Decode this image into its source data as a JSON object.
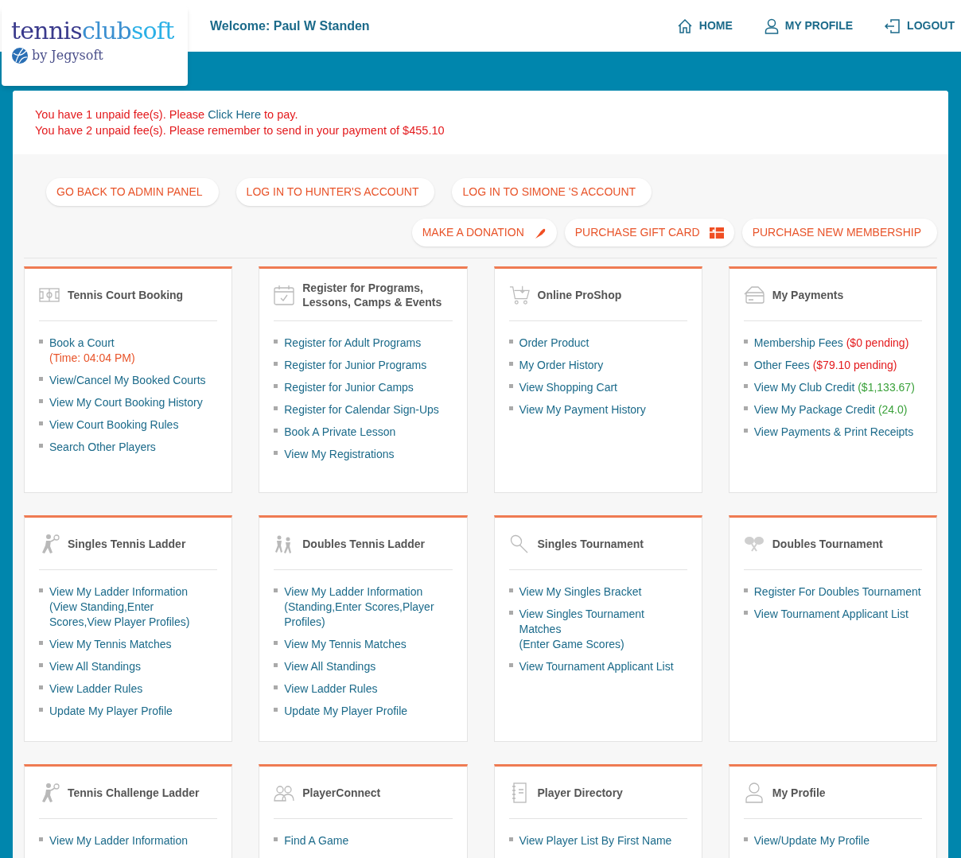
{
  "logo": {
    "name_parts": [
      "tennis",
      "club",
      "soft"
    ],
    "byline": "by Jegysoft"
  },
  "welcome": "Welcome: Paul W Standen",
  "nav": [
    {
      "label": "HOME",
      "kind": "home"
    },
    {
      "label": "MY PROFILE",
      "kind": "user"
    },
    {
      "label": "LOGOUT",
      "kind": "logout"
    }
  ],
  "alerts": [
    {
      "before": "You have 1 unpaid fee(s). Please ",
      "link": "Click Here",
      "after": " to pay."
    },
    {
      "before": "You have 2 unpaid fee(s). Please remember to send in your payment of $455.10"
    }
  ],
  "action_rows": [
    [
      {
        "label": "GO BACK TO ADMIN PANEL"
      },
      {
        "label": "LOG IN TO HUNTER'S ACCOUNT"
      },
      {
        "label": "LOG IN TO SIMONE 'S ACCOUNT"
      }
    ],
    [
      {
        "label": "MAKE A DONATION",
        "kind": "donate"
      },
      {
        "label": "PURCHASE GIFT CARD",
        "kind": "gift"
      },
      {
        "label": "PURCHASE NEW MEMBERSHIP"
      }
    ]
  ],
  "cards": [
    {
      "title": "Tennis Court Booking",
      "kind": "court",
      "items": [
        {
          "label": "Book a Court",
          "note": "(Time: 04:04 PM)",
          "kind": "time"
        },
        {
          "label": "View/Cancel My Booked Courts"
        },
        {
          "label": "View My Court Booking History"
        },
        {
          "label": "View Court Booking Rules"
        },
        {
          "label": "Search Other Players"
        }
      ]
    },
    {
      "title": "Register for Programs, Lessons, Camps & Events",
      "kind": "calendar",
      "items": [
        {
          "label": "Register for Adult Programs"
        },
        {
          "label": "Register for Junior Programs"
        },
        {
          "label": "Register for Junior Camps"
        },
        {
          "label": "Register for Calendar Sign-Ups"
        },
        {
          "label": "Book A Private Lesson"
        },
        {
          "label": "View My Registrations"
        }
      ]
    },
    {
      "title": "Online ProShop",
      "kind": "cart",
      "items": [
        {
          "label": "Order Product"
        },
        {
          "label": "My Order History"
        },
        {
          "label": "View Shopping Cart"
        },
        {
          "label": "View My Payment History"
        }
      ]
    },
    {
      "title": "My Payments",
      "kind": "card",
      "items": [
        {
          "label": "Membership Fees",
          "note": "($0 pending)",
          "kind": "due"
        },
        {
          "label": "Other Fees",
          "note": "($79.10 pending)",
          "kind": "due"
        },
        {
          "label": "View My Club Credit",
          "note": "($1,133.67)",
          "kind": "credit"
        },
        {
          "label": "View My Package Credit",
          "note": "(24.0)",
          "kind": "credit"
        },
        {
          "label": "View Payments & Print Receipts"
        }
      ]
    },
    {
      "title": "Singles Tennis Ladder",
      "kind": "player",
      "items": [
        {
          "label": "View My Ladder Information (View Standing,Enter Scores,View Player Profiles)"
        },
        {
          "label": "View My Tennis Matches"
        },
        {
          "label": "View All Standings"
        },
        {
          "label": "View Ladder Rules"
        },
        {
          "label": "Update My Player Profile"
        }
      ]
    },
    {
      "title": "Doubles Tennis Ladder",
      "kind": "players",
      "items": [
        {
          "label": "View My Ladder Information (Standing,Enter Scores,Player Profiles)"
        },
        {
          "label": "View My Tennis Matches"
        },
        {
          "label": "View All Standings"
        },
        {
          "label": "View Ladder Rules"
        },
        {
          "label": "Update My Player Profile"
        }
      ]
    },
    {
      "title": "Singles Tournament",
      "kind": "racket",
      "items": [
        {
          "label": "View My Singles Bracket"
        },
        {
          "label": "View Singles Tournament Matches",
          "note": "(Enter Game Scores)",
          "kind": "plain"
        },
        {
          "label": "View Tournament Applicant List"
        }
      ]
    },
    {
      "title": "Doubles Tournament",
      "kind": "rackets",
      "items": [
        {
          "label": "Register For Doubles Tournament"
        },
        {
          "label": "View Tournament Applicant List"
        }
      ]
    },
    {
      "title": "Tennis Challenge Ladder",
      "kind": "player",
      "items": [
        {
          "label": "View My Ladder Information"
        }
      ]
    },
    {
      "title": "PlayerConnect",
      "kind": "people",
      "items": [
        {
          "label": "Find A Game"
        }
      ]
    },
    {
      "title": "Player Directory",
      "kind": "book",
      "items": [
        {
          "label": "View Player List By First Name"
        }
      ]
    },
    {
      "title": "My Profile",
      "kind": "user",
      "items": [
        {
          "label": "View/Update My Profile"
        }
      ]
    }
  ]
}
